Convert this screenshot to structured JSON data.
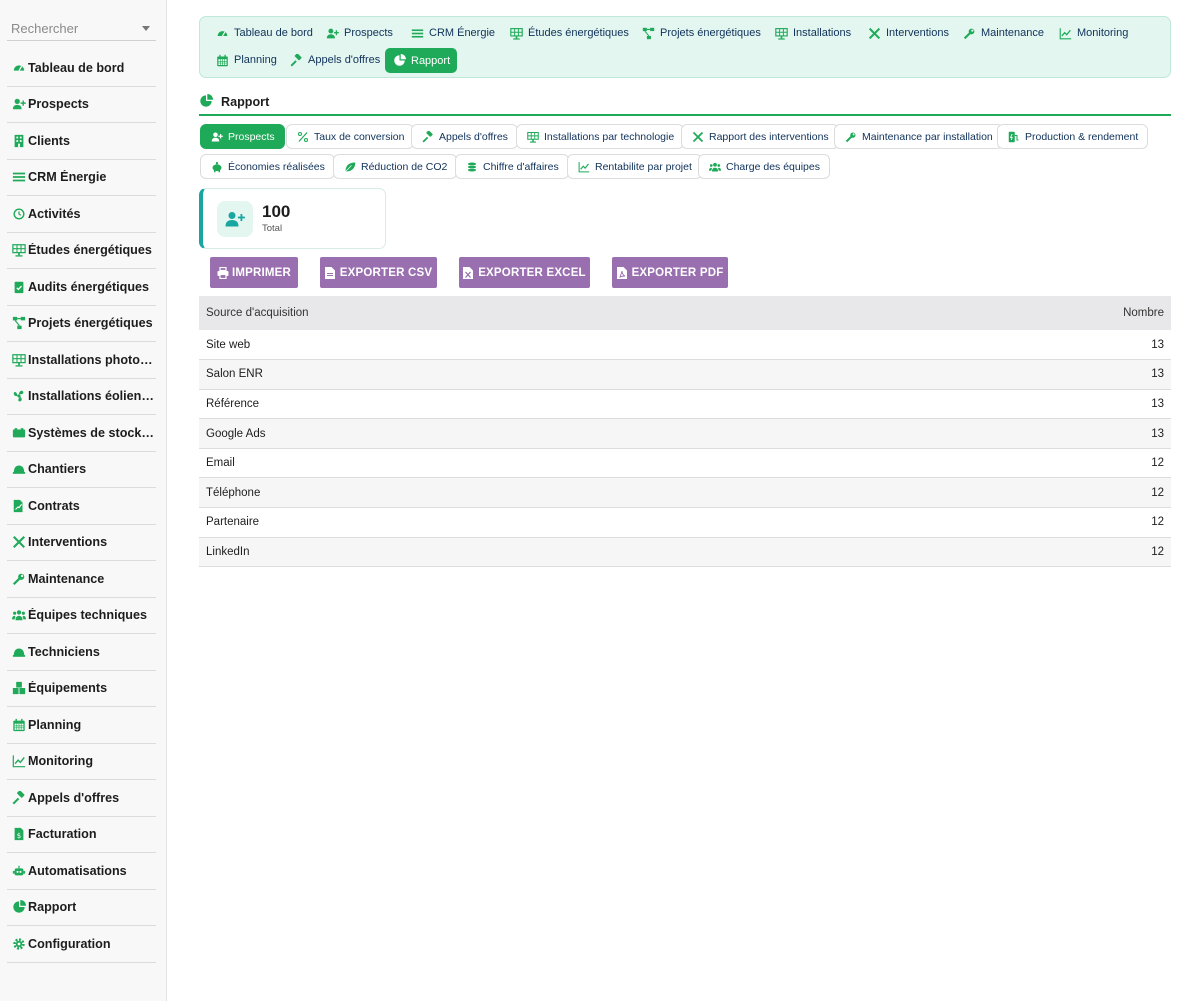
{
  "search": {
    "placeholder": "Rechercher"
  },
  "sidebar": {
    "items": [
      {
        "label": "Tableau de bord",
        "icon": "gauge-icon"
      },
      {
        "label": "Prospects",
        "icon": "user-plus-icon"
      },
      {
        "label": "Clients",
        "icon": "building-icon"
      },
      {
        "label": "CRM Énergie",
        "icon": "list-icon"
      },
      {
        "label": "Activités",
        "icon": "history-icon"
      },
      {
        "label": "Études énergétiques",
        "icon": "solar-panel-icon"
      },
      {
        "label": "Audits énergétiques",
        "icon": "clipboard-check-icon"
      },
      {
        "label": "Projets énergétiques",
        "icon": "project-diagram-icon"
      },
      {
        "label": "Installations photovoltaïques",
        "icon": "solar-panel-icon"
      },
      {
        "label": "Installations éoliennes",
        "icon": "fan-icon"
      },
      {
        "label": "Systèmes de stockage",
        "icon": "battery-icon"
      },
      {
        "label": "Chantiers",
        "icon": "hard-hat-icon"
      },
      {
        "label": "Contrats",
        "icon": "file-signature-icon"
      },
      {
        "label": "Interventions",
        "icon": "tools-icon"
      },
      {
        "label": "Maintenance",
        "icon": "wrench-icon"
      },
      {
        "label": "Équipes techniques",
        "icon": "users-icon"
      },
      {
        "label": "Techniciens",
        "icon": "hard-hat-icon"
      },
      {
        "label": "Équipements",
        "icon": "boxes-icon"
      },
      {
        "label": "Planning",
        "icon": "calendar-icon"
      },
      {
        "label": "Monitoring",
        "icon": "chart-line-icon"
      },
      {
        "label": "Appels d'offres",
        "icon": "gavel-icon"
      },
      {
        "label": "Facturation",
        "icon": "invoice-icon"
      },
      {
        "label": "Automatisations",
        "icon": "robot-icon"
      },
      {
        "label": "Rapport",
        "icon": "chart-pie-icon"
      },
      {
        "label": "Configuration",
        "icon": "cog-icon"
      }
    ]
  },
  "topnav": {
    "items": [
      {
        "label": "Tableau de bord",
        "icon": "gauge-icon"
      },
      {
        "label": "Prospects",
        "icon": "user-plus-icon"
      },
      {
        "label": "CRM Énergie",
        "icon": "list-icon"
      },
      {
        "label": "Études énergétiques",
        "icon": "solar-panel-icon"
      },
      {
        "label": "Projets énergétiques",
        "icon": "project-diagram-icon"
      },
      {
        "label": "Installations",
        "icon": "solar-panel-icon"
      },
      {
        "label": "Interventions",
        "icon": "tools-icon"
      },
      {
        "label": "Maintenance",
        "icon": "wrench-icon"
      },
      {
        "label": "Monitoring",
        "icon": "chart-line-icon"
      },
      {
        "label": "Planning",
        "icon": "calendar-icon"
      },
      {
        "label": "Appels d'offres",
        "icon": "gavel-icon"
      },
      {
        "label": "Rapport",
        "icon": "chart-pie-icon",
        "active": true
      }
    ]
  },
  "section": {
    "title": "Rapport"
  },
  "report_tabs": [
    {
      "label": "Prospects",
      "icon": "user-plus-icon",
      "active": true
    },
    {
      "label": "Taux de conversion",
      "icon": "percent-icon"
    },
    {
      "label": "Appels d'offres",
      "icon": "gavel-icon"
    },
    {
      "label": "Installations par technologie",
      "icon": "solar-panel-icon"
    },
    {
      "label": "Rapport des interventions",
      "icon": "tools-icon"
    },
    {
      "label": "Maintenance par installation",
      "icon": "wrench-icon"
    },
    {
      "label": "Production & rendement",
      "icon": "charging-station-icon"
    },
    {
      "label": "Économies réalisées",
      "icon": "piggy-bank-icon"
    },
    {
      "label": "Réduction de CO2",
      "icon": "leaf-icon"
    },
    {
      "label": "Chiffre d'affaires",
      "icon": "coins-icon"
    },
    {
      "label": "Rentabilite par projet",
      "icon": "chart-line-icon"
    },
    {
      "label": "Charge des équipes",
      "icon": "users-icon"
    }
  ],
  "stat": {
    "value": "100",
    "label": "Total",
    "icon": "user-plus-icon"
  },
  "buttons": {
    "print": "IMPRIMER",
    "csv": "EXPORTER CSV",
    "excel": "EXPORTER EXCEL",
    "pdf": "EXPORTER PDF"
  },
  "table": {
    "headers": [
      "Source d'acquisition",
      "Nombre"
    ],
    "rows": [
      {
        "source": "Site web",
        "count": "13"
      },
      {
        "source": "Salon ENR",
        "count": "13"
      },
      {
        "source": "Référence",
        "count": "13"
      },
      {
        "source": "Google Ads",
        "count": "13"
      },
      {
        "source": "Email",
        "count": "12"
      },
      {
        "source": "Téléphone",
        "count": "12"
      },
      {
        "source": "Partenaire",
        "count": "12"
      },
      {
        "source": "LinkedIn",
        "count": "12"
      }
    ]
  },
  "colors": {
    "accent": "#1faa59",
    "nav_bg": "#e3f6f0",
    "export_button": "#9a6fb0",
    "stat_border": "#1aa6a0"
  }
}
